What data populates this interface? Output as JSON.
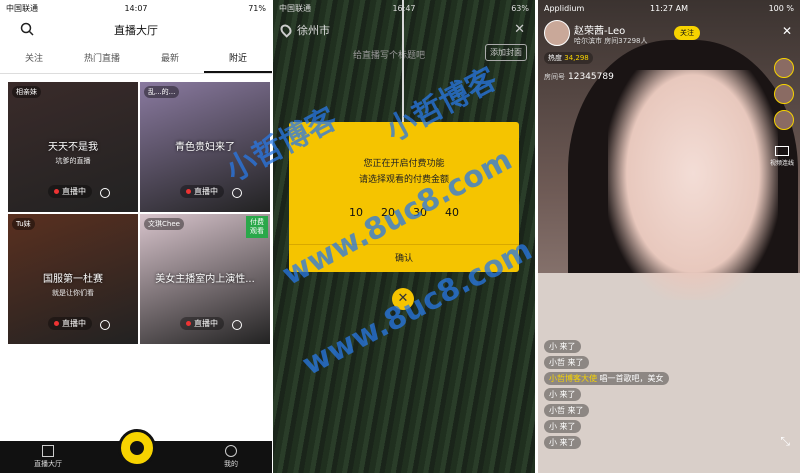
{
  "phone1": {
    "status": {
      "carrier": "中国联通",
      "time": "14:07",
      "battery": "71%"
    },
    "title": "直播大厅",
    "tabs": [
      "关注",
      "热门直播",
      "最新",
      "附近"
    ],
    "cards": [
      {
        "tag": "相亲妹",
        "title": "天天不是我",
        "sub": "坑爹的直播",
        "live": "直播中",
        "color": "#3a2b2a"
      },
      {
        "tag": "乱...的...",
        "title": "青色贵妇来了",
        "sub": "",
        "live": "直播中",
        "color": "#8a7aa0"
      },
      {
        "tag": "Tu妹",
        "title": "国服第一杜赛",
        "sub": "就是让你们看",
        "live": "直播中",
        "color": "#5a3020"
      },
      {
        "tag": "文琪Chee",
        "title": "美女主播室内上演性...",
        "sub": "",
        "live": "直播中",
        "color": "#d8c4cc",
        "paid": "付费观看"
      }
    ],
    "nav": [
      "直播大厅",
      "我的"
    ]
  },
  "phone2": {
    "status": {
      "carrier": "中国联通",
      "time": "16:47",
      "battery": "63%"
    },
    "location": "徐州市",
    "title_placeholder": "给直播写个标题吧",
    "add_cover": "添加封面",
    "modal": {
      "line1": "您正在开启付费功能",
      "line2": "请选择观看的付费金额",
      "options": [
        "10",
        "20",
        "30",
        "40"
      ],
      "confirm": "确认"
    }
  },
  "phone3": {
    "status": {
      "carrier": "Applidium",
      "time": "11:27 AM",
      "battery": "100 %"
    },
    "host_name": "赵荣茜-Leo",
    "host_location": "哈尔滨市",
    "host_room_short": "房间37298人",
    "follow_label": "关注",
    "heat_label": "热度",
    "heat_value": "34,298",
    "room_label": "房间号",
    "room_number": "12345789",
    "video_link": "视频连线",
    "chat": [
      {
        "user": "小",
        "msg": "来了"
      },
      {
        "user": "小哲",
        "msg": "来了"
      },
      {
        "user": "小哲博客大使",
        "msg": "唱一首歌吧，美女",
        "yellow": true
      },
      {
        "user": "小",
        "msg": "来了"
      },
      {
        "user": "小哲",
        "msg": "来了"
      },
      {
        "user": "小",
        "msg": "来了"
      },
      {
        "user": "小",
        "msg": "来了"
      }
    ]
  },
  "watermark": {
    "brand": "小哲博客",
    "url": "www.8uc8.com"
  }
}
